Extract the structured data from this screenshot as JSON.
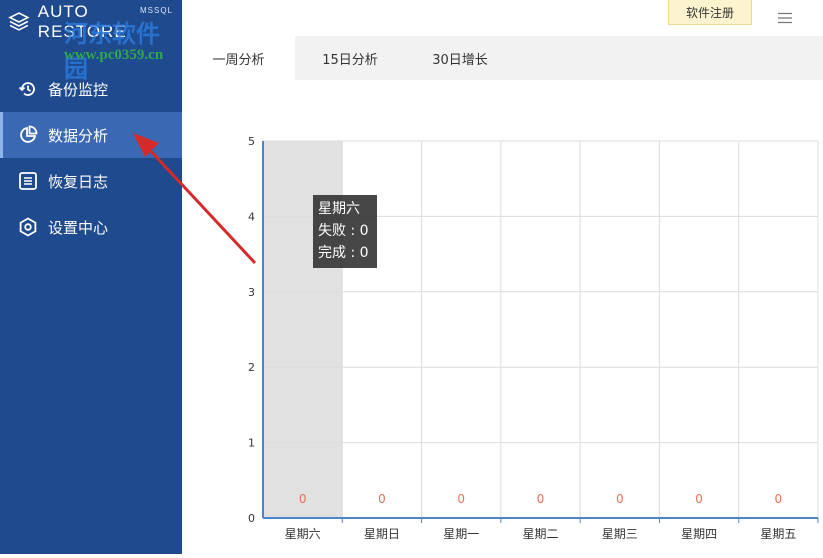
{
  "app": {
    "title": "AUTO RESTORE",
    "edition": "MSSQL",
    "watermark": "河东软件园",
    "watermark_url": "www.pc0359.cn"
  },
  "sidebar": {
    "items": [
      {
        "label": "备份监控",
        "icon": "backup-history-icon",
        "active": false
      },
      {
        "label": "数据分析",
        "icon": "pie-chart-icon",
        "active": true
      },
      {
        "label": "恢复日志",
        "icon": "log-list-icon",
        "active": false
      },
      {
        "label": "设置中心",
        "icon": "settings-gear-icon",
        "active": false
      }
    ]
  },
  "header": {
    "register_label": "软件注册",
    "menu_icon": "hamburger-menu-icon"
  },
  "tabs": [
    {
      "label": "一周分析",
      "active": true
    },
    {
      "label": "15日分析",
      "active": false
    },
    {
      "label": "30日增长",
      "active": false
    }
  ],
  "chart_data": {
    "type": "bar",
    "categories": [
      "星期六",
      "星期日",
      "星期一",
      "星期二",
      "星期三",
      "星期四",
      "星期五"
    ],
    "series": [
      {
        "name": "失败",
        "values": [
          0,
          0,
          0,
          0,
          0,
          0,
          0
        ]
      },
      {
        "name": "完成",
        "values": [
          0,
          0,
          0,
          0,
          0,
          0,
          0
        ]
      }
    ],
    "data_labels": [
      "0",
      "0",
      "0",
      "0",
      "0",
      "0",
      "0"
    ],
    "ylim": [
      0,
      5
    ],
    "yticks": [
      "0",
      "1",
      "2",
      "3",
      "4",
      "5"
    ],
    "grid": true,
    "highlighted_category": "星期六",
    "label_color": "#e0735a",
    "axis_color": "#4a86c8"
  },
  "tooltip": {
    "title": "星期六",
    "line1": "失败 : 0",
    "line2": "完成 : 0"
  },
  "colors": {
    "sidebar": "#1f4a8e",
    "sidebar_active": "#3b68b2",
    "annotation_arrow": "#d42a2a"
  }
}
